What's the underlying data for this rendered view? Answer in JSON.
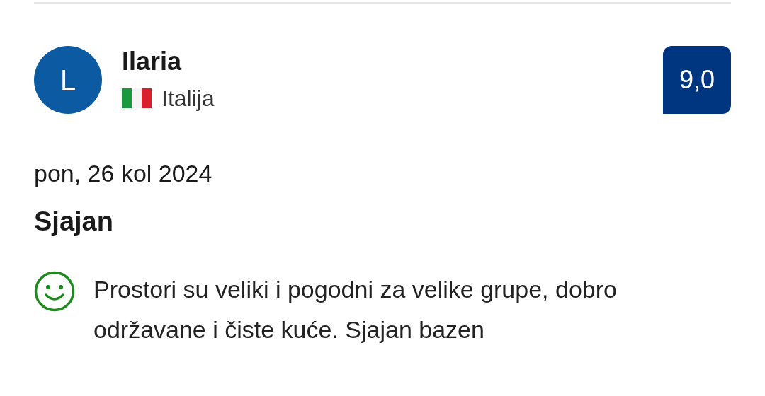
{
  "reviewer": {
    "initial": "L",
    "name": "Ilaria",
    "country": "Italija"
  },
  "score": "9,0",
  "date": "pon, 26 kol 2024",
  "title": "Sjajan",
  "positive": {
    "text": "Prostori su veliki i pogodni za velike grupe, dobro održavane i čiste kuće. Sjajan bazen"
  }
}
